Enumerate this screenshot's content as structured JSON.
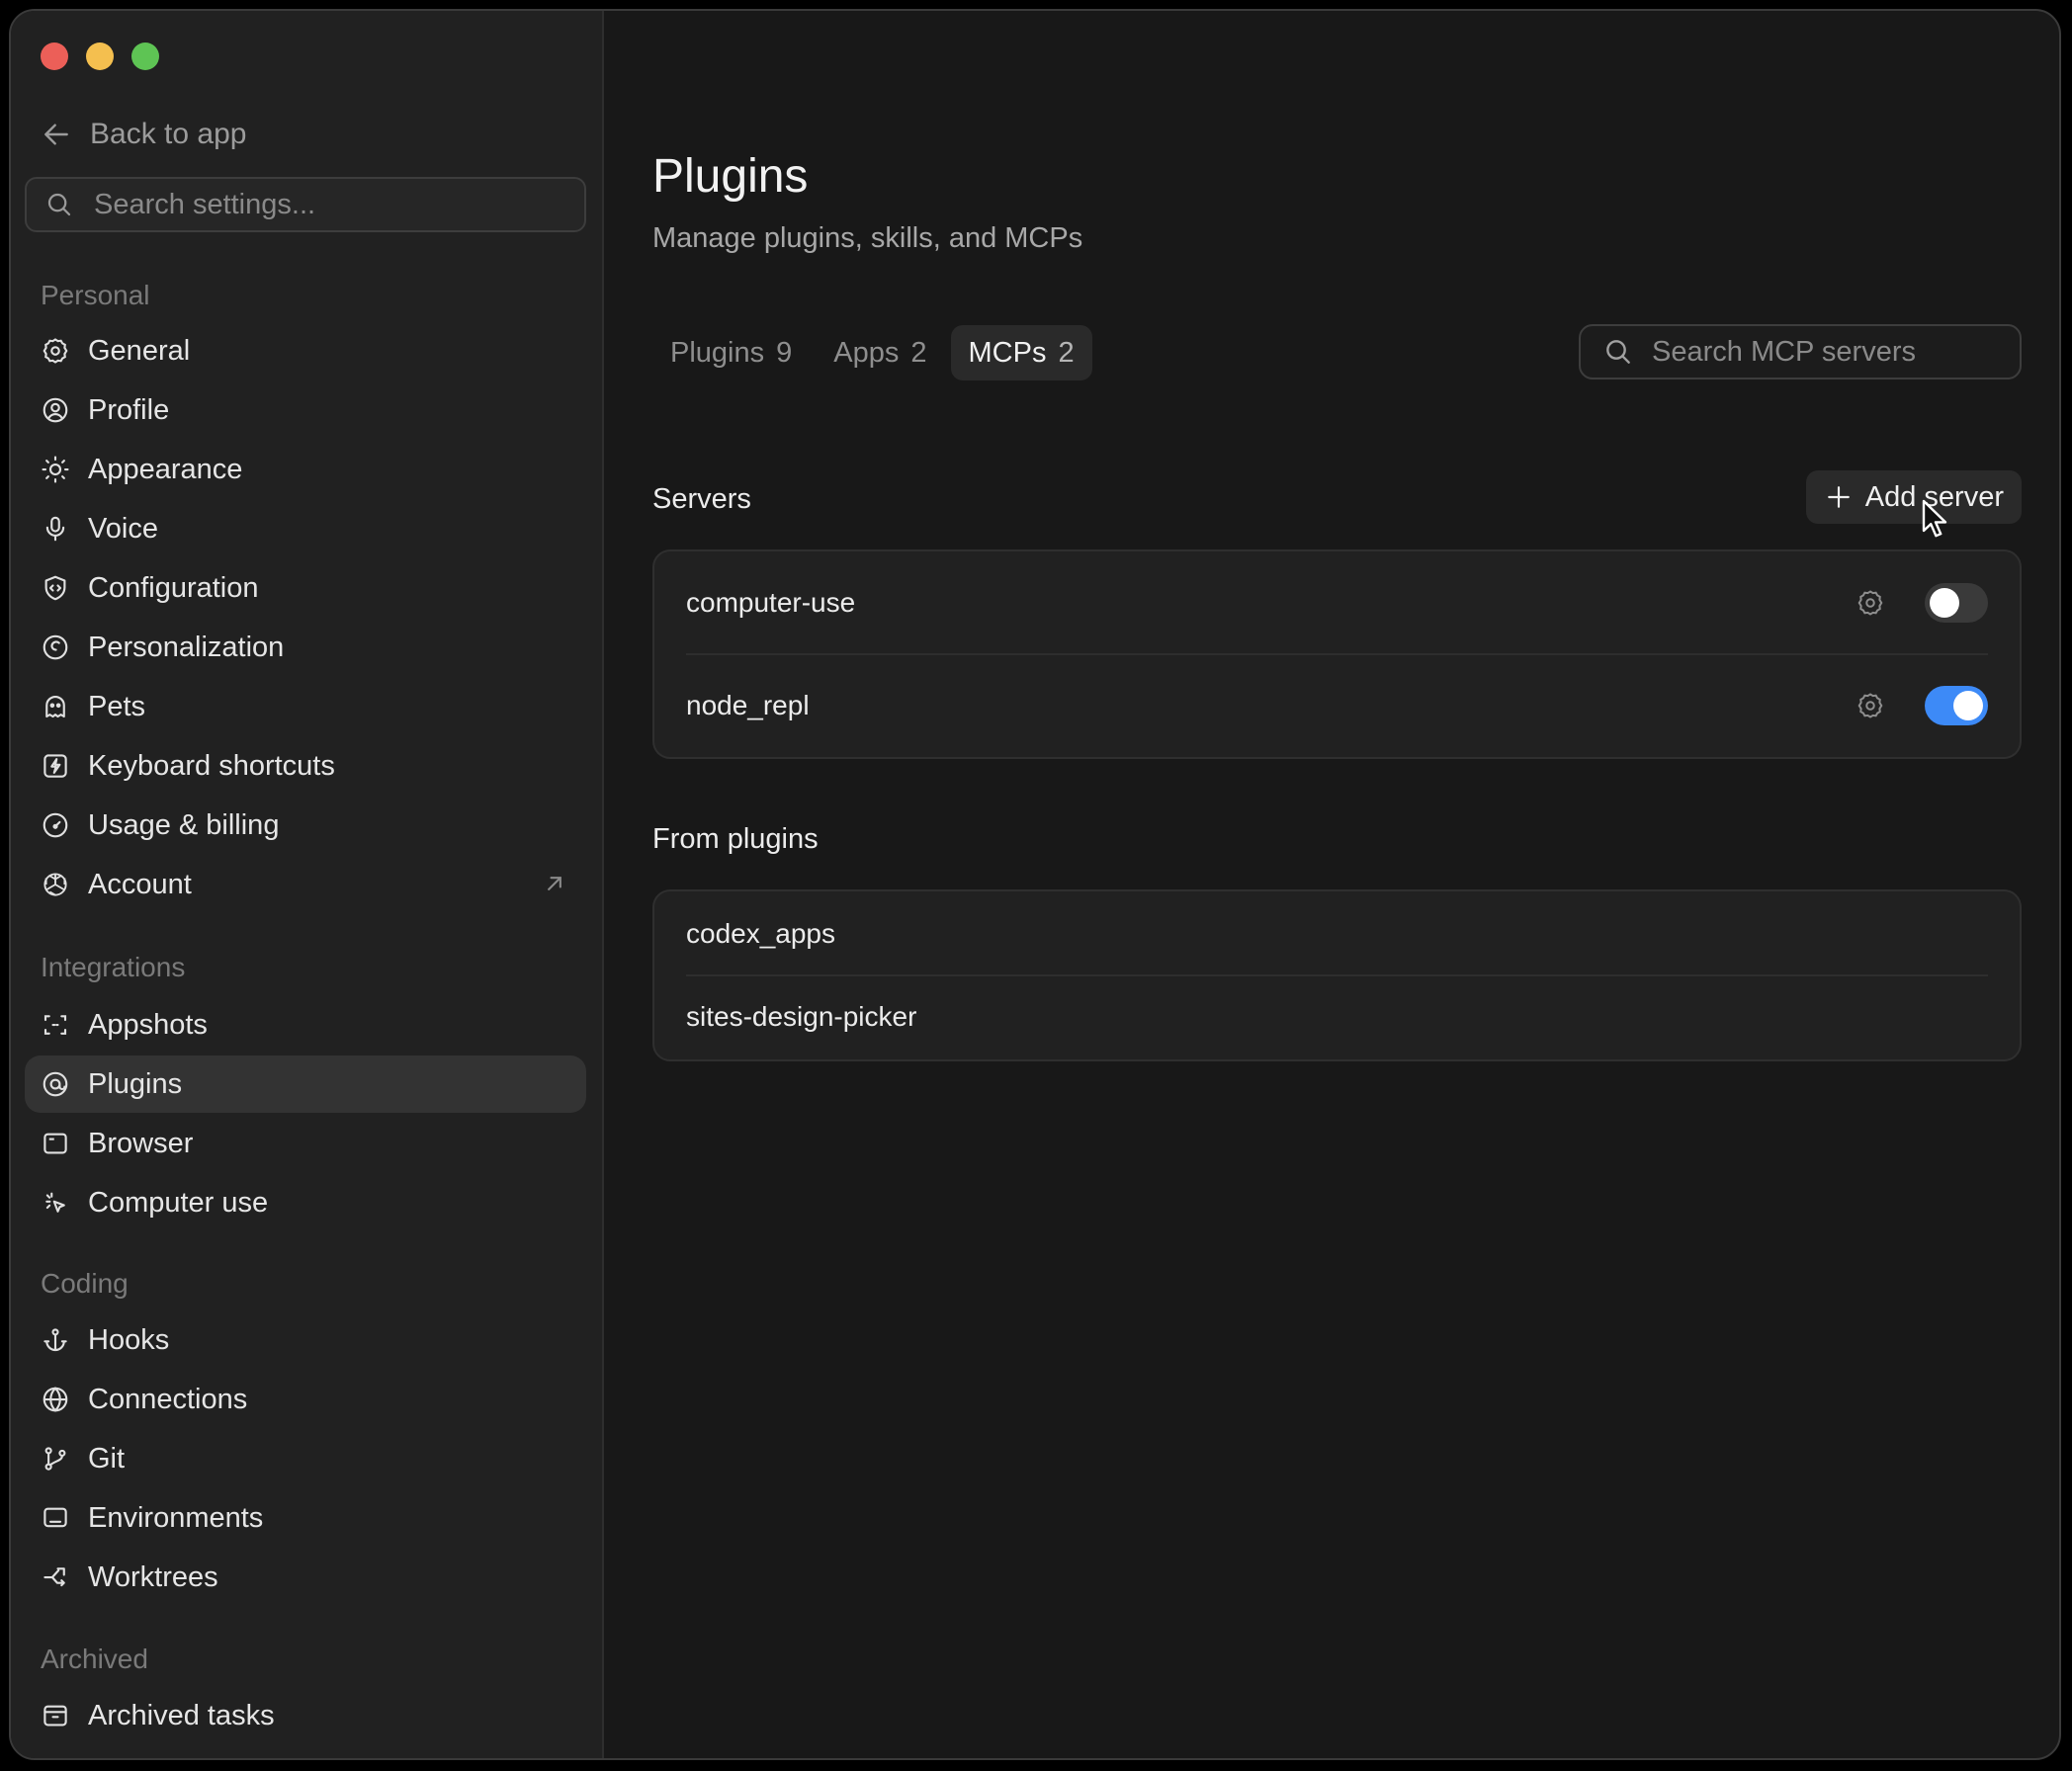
{
  "sidebar": {
    "back_label": "Back to app",
    "search_placeholder": "Search settings...",
    "sections": {
      "personal": "Personal",
      "integrations": "Integrations",
      "coding": "Coding",
      "archived": "Archived"
    },
    "items": {
      "general": "General",
      "profile": "Profile",
      "appearance": "Appearance",
      "voice": "Voice",
      "configuration": "Configuration",
      "personalization": "Personalization",
      "pets": "Pets",
      "keyboard_shortcuts": "Keyboard shortcuts",
      "usage_billing": "Usage & billing",
      "account": "Account",
      "appshots": "Appshots",
      "plugins": "Plugins",
      "browser": "Browser",
      "computer_use": "Computer use",
      "hooks": "Hooks",
      "connections": "Connections",
      "git": "Git",
      "environments": "Environments",
      "worktrees": "Worktrees",
      "archived_tasks": "Archived tasks"
    },
    "active_item": "plugins"
  },
  "main": {
    "title": "Plugins",
    "subtitle": "Manage plugins, skills, and MCPs",
    "tabs": [
      {
        "label": "Plugins",
        "count": "9"
      },
      {
        "label": "Apps",
        "count": "2"
      },
      {
        "label": "MCPs",
        "count": "2",
        "active": true
      }
    ],
    "search_placeholder": "Search MCP servers",
    "servers_title": "Servers",
    "add_server_label": "Add server",
    "servers": [
      {
        "name": "computer-use",
        "enabled": false
      },
      {
        "name": "node_repl",
        "enabled": true
      }
    ],
    "from_plugins_title": "From plugins",
    "plugin_servers": [
      {
        "name": "codex_apps"
      },
      {
        "name": "sites-design-picker"
      }
    ]
  },
  "colors": {
    "toggle_on": "#3d8af7",
    "window_bg": "#181818",
    "sidebar_bg": "#212121"
  }
}
